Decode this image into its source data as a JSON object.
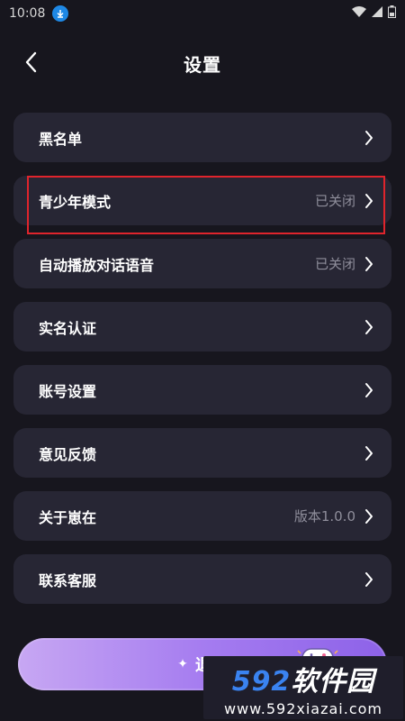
{
  "status_bar": {
    "time": "10:08"
  },
  "header": {
    "title": "设置"
  },
  "settings": {
    "items": [
      {
        "label": "黑名单",
        "value": ""
      },
      {
        "label": "青少年模式",
        "value": "已关闭"
      },
      {
        "label": "自动播放对话语音",
        "value": "已关闭"
      },
      {
        "label": "实名认证",
        "value": ""
      },
      {
        "label": "账号设置",
        "value": ""
      },
      {
        "label": "意见反馈",
        "value": ""
      },
      {
        "label": "关于崽在",
        "value": "版本1.0.0"
      },
      {
        "label": "联系客服",
        "value": ""
      }
    ]
  },
  "logout": {
    "label": "退出"
  },
  "watermark": {
    "brand_num": "592",
    "brand_text": "软件园",
    "url": "www.592xiazai.com"
  },
  "colors": {
    "background": "#17161e",
    "card": "#272634",
    "highlight_border": "#e0242c",
    "secondary_text": "#8f8e9b",
    "logout_gradient_start": "#c7a7f3",
    "logout_gradient_end": "#8d62e8"
  },
  "icons": {
    "back": "chevron-left-icon",
    "row_arrow": "chevron-right-icon",
    "download": "download-icon",
    "wifi": "wifi-icon",
    "signal": "signal-icon",
    "battery": "battery-icon"
  }
}
